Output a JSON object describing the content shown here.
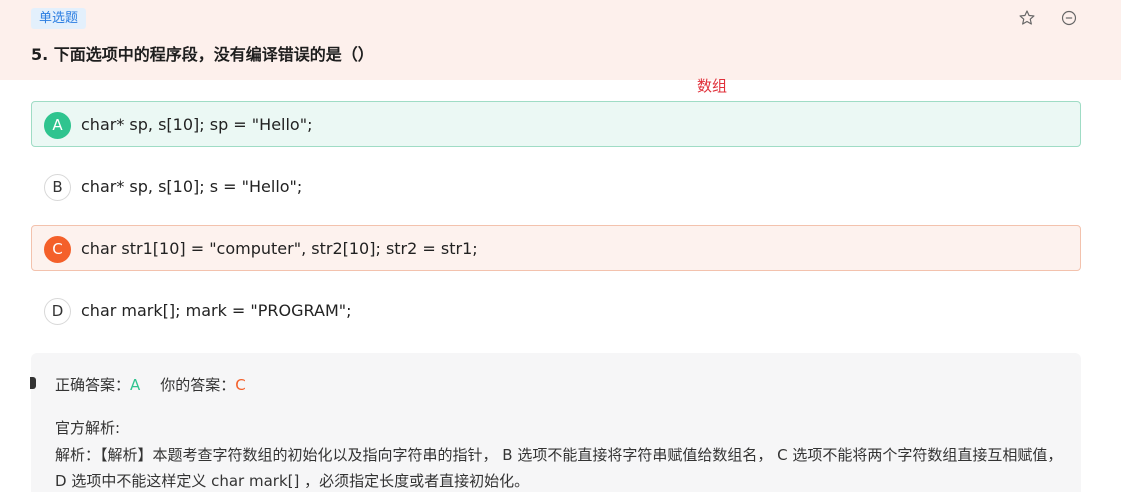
{
  "question": {
    "type_tag": "单选题",
    "title": "5. 下面选项中的程序段，没有编译错误的是（）",
    "icons": {
      "favorite": "star-outline-icon",
      "remove": "minus-circle-icon"
    }
  },
  "annotation": "数组",
  "options": [
    {
      "letter": "A",
      "text": "char* sp, s[10]; sp = \"Hello\";",
      "state": "correct"
    },
    {
      "letter": "B",
      "text": "char* sp, s[10]; s = \"Hello\";",
      "state": "plain"
    },
    {
      "letter": "C",
      "text": "char str1[10] = \"computer\", str2[10]; str2 = str1;",
      "state": "wrong"
    },
    {
      "letter": "D",
      "text": "char mark[]; mark = \"PROGRAM\";",
      "state": "plain"
    }
  ],
  "answer": {
    "correct_label": "正确答案：",
    "correct_value": "A",
    "yours_label": "你的答案：",
    "yours_value": "C",
    "official_label": "官方解析:",
    "analysis_text": "解析：【解析】本题考查字符数组的初始化以及指向字符串的指针， B 选项不能直接将字符串赋值给数组名， C 选项不能将两个字符数组直接互相赋值， D 选项中不能这样定义 char mark[] ，必须指定长度或者直接初始化。"
  },
  "colors": {
    "header_bg": "#fdf0ec",
    "tag_bg": "#e3f0fc",
    "tag_text": "#2a7de1",
    "correct": "#2fc48f",
    "wrong": "#f4602a",
    "annotation": "#e0303a"
  }
}
